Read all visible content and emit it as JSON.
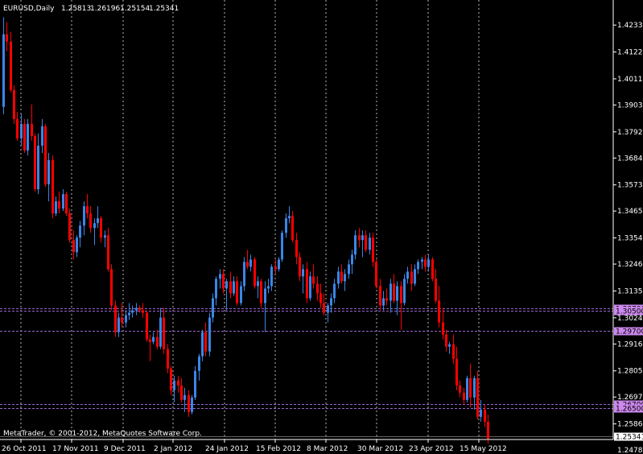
{
  "header": {
    "symbol": "EURUSD,Daily",
    "open": "1.25813",
    "high": "1.26196",
    "low": "1.25154",
    "close": "1.25341"
  },
  "copyright": "MetaTrader, © 2001-2012, MetaQuotes Software Corp.",
  "colors": {
    "background": "#000000",
    "bull": "#3a86e8",
    "bear": "#ff0000",
    "grid": "#ffffff",
    "hline": "#9966cc",
    "label_bg": "#cc88ee",
    "axis_text": "#ffffff"
  },
  "chart_data": {
    "type": "candlestick",
    "ylim": [
      1.2475,
      1.428
    ],
    "y_ticks": [
      "1.42330",
      "1.41220",
      "1.40110",
      "1.39030",
      "1.37920",
      "1.36840",
      "1.35730",
      "1.34650",
      "1.33540",
      "1.32460",
      "1.31350",
      "1.30240",
      "1.29160",
      "1.28050",
      "1.26970",
      "1.25860",
      "1.24780"
    ],
    "x_ticks": [
      "26 Oct 2011",
      "17 Nov 2011",
      "9 Dec 2011",
      "2 Jan 2012",
      "24 Jan 2012",
      "15 Feb 2012",
      "8 Mar 2012",
      "30 Mar 2012",
      "23 Apr 2012",
      "15 May 2012"
    ],
    "candles_start": 1.4195,
    "candles_ohlc": [
      [
        1.3895,
        1.4265,
        1.3865,
        1.4195
      ],
      [
        1.4195,
        1.4245,
        1.4125,
        1.4165
      ],
      [
        1.4165,
        1.4205,
        1.3955,
        1.3965
      ],
      [
        1.3965,
        1.3985,
        1.3825,
        1.3845
      ],
      [
        1.3845,
        1.3875,
        1.3755,
        1.3765
      ],
      [
        1.3765,
        1.3865,
        1.3735,
        1.3825
      ],
      [
        1.3825,
        1.3845,
        1.3705,
        1.3715
      ],
      [
        1.3715,
        1.3845,
        1.3695,
        1.3825
      ],
      [
        1.3825,
        1.3905,
        1.3755,
        1.3775
      ],
      [
        1.3775,
        1.3785,
        1.3545,
        1.3555
      ],
      [
        1.3555,
        1.3785,
        1.3535,
        1.3735
      ],
      [
        1.3735,
        1.3845,
        1.3705,
        1.3815
      ],
      [
        1.3815,
        1.3825,
        1.3565,
        1.3575
      ],
      [
        1.3575,
        1.3705,
        1.3505,
        1.3675
      ],
      [
        1.3675,
        1.3695,
        1.3435,
        1.3455
      ],
      [
        1.3455,
        1.3525,
        1.3445,
        1.3505
      ],
      [
        1.3505,
        1.3545,
        1.3455,
        1.3475
      ],
      [
        1.3475,
        1.3555,
        1.3465,
        1.3535
      ],
      [
        1.3535,
        1.3545,
        1.3445,
        1.3455
      ],
      [
        1.3455,
        1.3475,
        1.3335,
        1.3345
      ],
      [
        1.3345,
        1.3385,
        1.3265,
        1.3295
      ],
      [
        1.3295,
        1.3365,
        1.3275,
        1.3355
      ],
      [
        1.3355,
        1.3425,
        1.3315,
        1.3405
      ],
      [
        1.3405,
        1.3505,
        1.3365,
        1.3485
      ],
      [
        1.3485,
        1.3535,
        1.3435,
        1.3455
      ],
      [
        1.3455,
        1.3485,
        1.3375,
        1.3395
      ],
      [
        1.3395,
        1.3435,
        1.3325,
        1.3415
      ],
      [
        1.3415,
        1.3485,
        1.3395,
        1.3435
      ],
      [
        1.3435,
        1.3445,
        1.3335,
        1.3355
      ],
      [
        1.3355,
        1.3385,
        1.3315,
        1.3365
      ],
      [
        1.3365,
        1.3395,
        1.3215,
        1.3225
      ],
      [
        1.3225,
        1.3245,
        1.3055,
        1.3075
      ],
      [
        1.3075,
        1.3095,
        1.2945,
        1.2965
      ],
      [
        1.2965,
        1.3045,
        1.2945,
        1.3025
      ],
      [
        1.3025,
        1.3085,
        1.2985,
        1.3005
      ],
      [
        1.3005,
        1.3055,
        1.2985,
        1.3035
      ],
      [
        1.3035,
        1.3085,
        1.3015,
        1.3045
      ],
      [
        1.3045,
        1.3075,
        1.3025,
        1.3055
      ],
      [
        1.3055,
        1.3085,
        1.3035,
        1.3065
      ],
      [
        1.3065,
        1.3075,
        1.3045,
        1.3055
      ],
      [
        1.3055,
        1.3085,
        1.3025,
        1.3045
      ],
      [
        1.3045,
        1.3055,
        1.2925,
        1.2935
      ],
      [
        1.2935,
        1.2955,
        1.2845,
        1.2925
      ],
      [
        1.2925,
        1.2965,
        1.2915,
        1.2945
      ],
      [
        1.2945,
        1.2975,
        1.2895,
        1.2905
      ],
      [
        1.2905,
        1.3065,
        1.2895,
        1.3025
      ],
      [
        1.3025,
        1.3065,
        1.2875,
        1.2895
      ],
      [
        1.2895,
        1.2915,
        1.2795,
        1.2815
      ],
      [
        1.2815,
        1.2825,
        1.2705,
        1.2725
      ],
      [
        1.2725,
        1.2785,
        1.2675,
        1.2765
      ],
      [
        1.2765,
        1.2785,
        1.2715,
        1.2745
      ],
      [
        1.2745,
        1.2775,
        1.2675,
        1.2685
      ],
      [
        1.2685,
        1.2735,
        1.2635,
        1.2705
      ],
      [
        1.2705,
        1.2725,
        1.2615,
        1.2635
      ],
      [
        1.2635,
        1.2705,
        1.2625,
        1.2695
      ],
      [
        1.2695,
        1.2825,
        1.2685,
        1.2805
      ],
      [
        1.2805,
        1.2875,
        1.2765,
        1.2865
      ],
      [
        1.2865,
        1.2975,
        1.2845,
        1.2965
      ],
      [
        1.2965,
        1.3005,
        1.2865,
        1.2885
      ],
      [
        1.2885,
        1.3045,
        1.2865,
        1.3025
      ],
      [
        1.3025,
        1.3125,
        1.3005,
        1.3105
      ],
      [
        1.3105,
        1.3195,
        1.3075,
        1.3185
      ],
      [
        1.3185,
        1.3225,
        1.3145,
        1.3205
      ],
      [
        1.3205,
        1.3225,
        1.3125,
        1.3145
      ],
      [
        1.3145,
        1.3185,
        1.3055,
        1.3175
      ],
      [
        1.3175,
        1.3215,
        1.3105,
        1.3125
      ],
      [
        1.3125,
        1.3195,
        1.3115,
        1.3175
      ],
      [
        1.3175,
        1.3195,
        1.3075,
        1.3085
      ],
      [
        1.3085,
        1.3175,
        1.3075,
        1.3155
      ],
      [
        1.3155,
        1.3275,
        1.3135,
        1.3255
      ],
      [
        1.3255,
        1.3305,
        1.3225,
        1.3235
      ],
      [
        1.3235,
        1.3285,
        1.3215,
        1.3265
      ],
      [
        1.3265,
        1.3275,
        1.3145,
        1.3155
      ],
      [
        1.3155,
        1.3195,
        1.3105,
        1.3175
      ],
      [
        1.3175,
        1.3185,
        1.3065,
        1.3085
      ],
      [
        1.3085,
        1.3175,
        1.2965,
        1.3145
      ],
      [
        1.3145,
        1.3185,
        1.3125,
        1.3155
      ],
      [
        1.3155,
        1.3245,
        1.3135,
        1.3235
      ],
      [
        1.3235,
        1.3265,
        1.3205,
        1.3225
      ],
      [
        1.3225,
        1.3275,
        1.3215,
        1.3265
      ],
      [
        1.3265,
        1.3385,
        1.3255,
        1.3375
      ],
      [
        1.3375,
        1.3455,
        1.3355,
        1.3435
      ],
      [
        1.3435,
        1.3485,
        1.3415,
        1.3445
      ],
      [
        1.3445,
        1.3465,
        1.3335,
        1.3345
      ],
      [
        1.3345,
        1.3375,
        1.3245,
        1.3275
      ],
      [
        1.3275,
        1.3295,
        1.3175,
        1.3195
      ],
      [
        1.3195,
        1.3245,
        1.3125,
        1.3225
      ],
      [
        1.3225,
        1.3255,
        1.3085,
        1.3105
      ],
      [
        1.3105,
        1.3215,
        1.3095,
        1.3195
      ],
      [
        1.3195,
        1.3245,
        1.3145,
        1.3165
      ],
      [
        1.3165,
        1.3195,
        1.3095,
        1.3125
      ],
      [
        1.3125,
        1.3165,
        1.3065,
        1.3085
      ],
      [
        1.3085,
        1.3125,
        1.3035,
        1.3045
      ],
      [
        1.3045,
        1.3085,
        1.3005,
        1.3075
      ],
      [
        1.3075,
        1.3125,
        1.3045,
        1.3105
      ],
      [
        1.3105,
        1.3185,
        1.3085,
        1.3165
      ],
      [
        1.3165,
        1.3235,
        1.3145,
        1.3215
      ],
      [
        1.3215,
        1.3245,
        1.3165,
        1.3175
      ],
      [
        1.3175,
        1.3225,
        1.3135,
        1.3205
      ],
      [
        1.3205,
        1.3265,
        1.3185,
        1.3245
      ],
      [
        1.3245,
        1.3305,
        1.3205,
        1.3285
      ],
      [
        1.3285,
        1.3385,
        1.3265,
        1.3365
      ],
      [
        1.3365,
        1.3395,
        1.3315,
        1.3345
      ],
      [
        1.3345,
        1.3385,
        1.3275,
        1.3365
      ],
      [
        1.3365,
        1.3385,
        1.3295,
        1.3305
      ],
      [
        1.3305,
        1.3375,
        1.3285,
        1.3355
      ],
      [
        1.3355,
        1.3375,
        1.3235,
        1.3255
      ],
      [
        1.3255,
        1.3265,
        1.3145,
        1.3155
      ],
      [
        1.3155,
        1.3185,
        1.3055,
        1.3075
      ],
      [
        1.3075,
        1.3135,
        1.3055,
        1.3105
      ],
      [
        1.3105,
        1.3145,
        1.3075,
        1.3095
      ],
      [
        1.3095,
        1.3185,
        1.3045,
        1.3165
      ],
      [
        1.3165,
        1.3205,
        1.3085,
        1.3095
      ],
      [
        1.3095,
        1.3175,
        1.3035,
        1.3155
      ],
      [
        1.3155,
        1.3175,
        1.2975,
        1.3085
      ],
      [
        1.3085,
        1.3205,
        1.3075,
        1.3185
      ],
      [
        1.3185,
        1.3235,
        1.3165,
        1.3215
      ],
      [
        1.3215,
        1.3245,
        1.3135,
        1.3165
      ],
      [
        1.3165,
        1.3245,
        1.3155,
        1.3225
      ],
      [
        1.3225,
        1.3265,
        1.3205,
        1.3255
      ],
      [
        1.3255,
        1.3275,
        1.3225,
        1.3265
      ],
      [
        1.3265,
        1.3285,
        1.3215,
        1.3235
      ],
      [
        1.3235,
        1.3285,
        1.3215,
        1.3265
      ],
      [
        1.3265,
        1.3275,
        1.3175,
        1.3185
      ],
      [
        1.3185,
        1.3225,
        1.3085,
        1.3095
      ],
      [
        1.3095,
        1.3155,
        1.2985,
        1.3005
      ],
      [
        1.3005,
        1.3065,
        1.2935,
        1.2955
      ],
      [
        1.2955,
        1.2975,
        1.2885,
        1.2905
      ],
      [
        1.2905,
        1.2925,
        1.2875,
        1.2915
      ],
      [
        1.2915,
        1.2955,
        1.2835,
        1.2855
      ],
      [
        1.2855,
        1.2905,
        1.2725,
        1.2745
      ],
      [
        1.2745,
        1.2765,
        1.2695,
        1.2715
      ],
      [
        1.2715,
        1.2735,
        1.2665,
        1.2685
      ],
      [
        1.2685,
        1.2785,
        1.2675,
        1.2775
      ],
      [
        1.2775,
        1.2835,
        1.2655,
        1.2695
      ],
      [
        1.2695,
        1.2785,
        1.2645,
        1.2775
      ],
      [
        1.2775,
        1.2805,
        1.2605,
        1.2615
      ],
      [
        1.2615,
        1.2685,
        1.2595,
        1.2645
      ],
      [
        1.2645,
        1.2665,
        1.2575,
        1.2595
      ],
      [
        1.2595,
        1.2625,
        1.2505,
        1.2525
      ]
    ],
    "horizontal_lines": [
      {
        "price": 1.3065,
        "label": "1.30700"
      },
      {
        "price": 1.3052,
        "label": "1.30500"
      },
      {
        "price": 1.297,
        "label": "1.29700"
      },
      {
        "price": 1.2668,
        "label": "1.26700"
      },
      {
        "price": 1.265,
        "label": "1.26500"
      }
    ],
    "current_price": {
      "price": 1.25341,
      "label": "1.25341"
    },
    "grid": true
  }
}
